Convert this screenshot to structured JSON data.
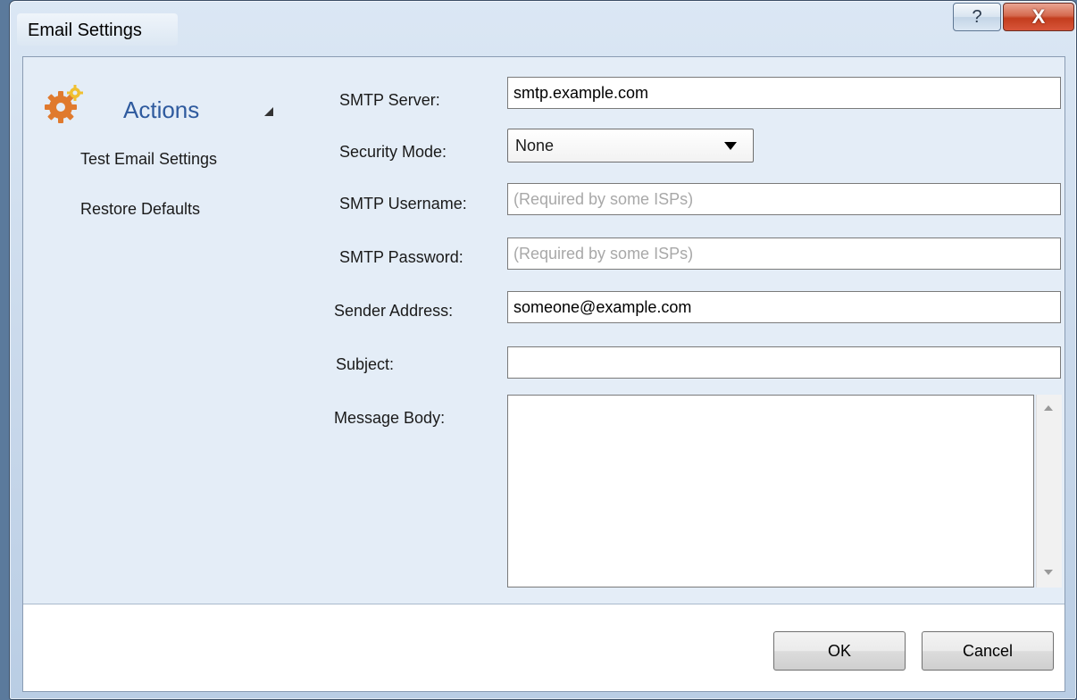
{
  "window": {
    "title": "Email Settings",
    "help_label": "?",
    "close_label": "X"
  },
  "sidebar": {
    "title": "Actions",
    "items": [
      {
        "label": "Test Email Settings"
      },
      {
        "label": "Restore Defaults"
      }
    ]
  },
  "form": {
    "smtp_server": {
      "label": "SMTP Server:",
      "value": "smtp.example.com"
    },
    "security_mode": {
      "label": "Security Mode:",
      "value": "None"
    },
    "smtp_username": {
      "label": "SMTP Username:",
      "value": "",
      "placeholder": "(Required by some ISPs)"
    },
    "smtp_password": {
      "label": "SMTP Password:",
      "value": "",
      "placeholder": "(Required by some ISPs)"
    },
    "sender_address": {
      "label": "Sender Address:",
      "value": "someone@example.com"
    },
    "subject": {
      "label": "Subject:",
      "value": ""
    },
    "message_body": {
      "label": "Message Body:",
      "value": ""
    }
  },
  "buttons": {
    "ok": "OK",
    "cancel": "Cancel"
  },
  "colors": {
    "accent": "#2e5a9e",
    "close": "#c33d1e",
    "gear": "#e07a2e"
  },
  "icons": {
    "actions": "gear-icon",
    "collapse": "collapse-triangle-icon"
  }
}
